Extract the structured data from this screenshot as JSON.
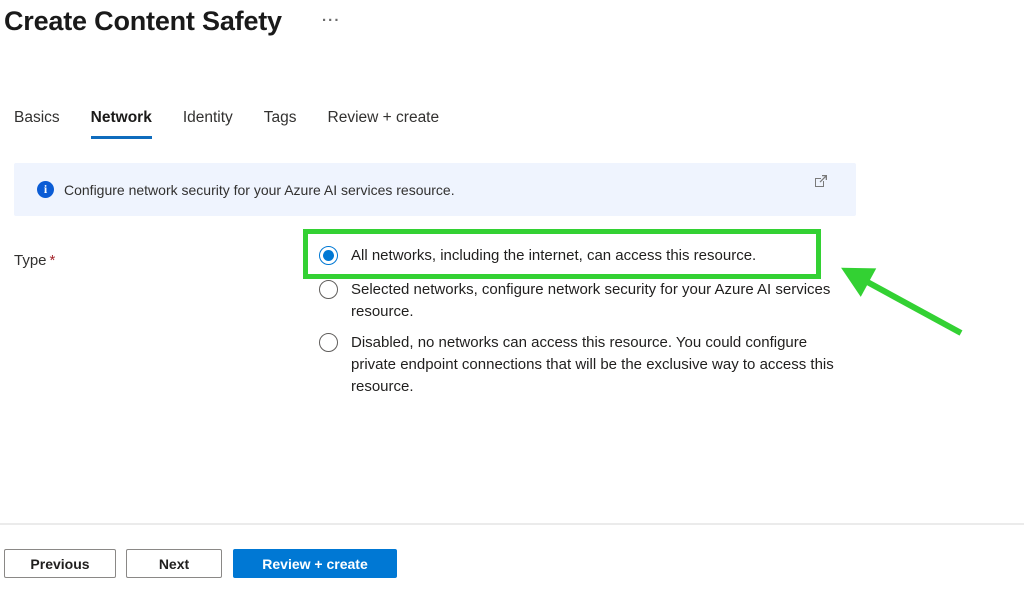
{
  "header": {
    "title": "Create Content Safety",
    "more_label": "..."
  },
  "tabs": [
    {
      "label": "Basics",
      "active": false
    },
    {
      "label": "Network",
      "active": true
    },
    {
      "label": "Identity",
      "active": false
    },
    {
      "label": "Tags",
      "active": false
    },
    {
      "label": "Review + create",
      "active": false
    }
  ],
  "banner": {
    "icon": "info-icon",
    "text": "Configure network security for your Azure AI services resource.",
    "link_icon": "external-link-icon"
  },
  "form": {
    "type_label": "Type",
    "required_marker": "*",
    "options": [
      {
        "label": "All networks, including the internet, can access this resource.",
        "selected": true
      },
      {
        "label": "Selected networks, configure network security for your Azure AI services resource.",
        "selected": false
      },
      {
        "label": "Disabled, no networks can access this resource. You could configure private endpoint connections that will be the exclusive way to access this resource.",
        "selected": false
      }
    ]
  },
  "annotation": {
    "highlight": "green box around selected option",
    "arrow": "green arrow pointing to highlighted option"
  },
  "footer": {
    "previous_label": "Previous",
    "next_label": "Next",
    "review_create_label": "Review + create"
  },
  "colors": {
    "accent": "#0078d4",
    "tab_underline": "#0f6cbd",
    "banner_bg": "#eff4fe",
    "info_icon_blue": "#0b5cd5",
    "required_red": "#a4262c",
    "annotation_green": "#33d133"
  }
}
